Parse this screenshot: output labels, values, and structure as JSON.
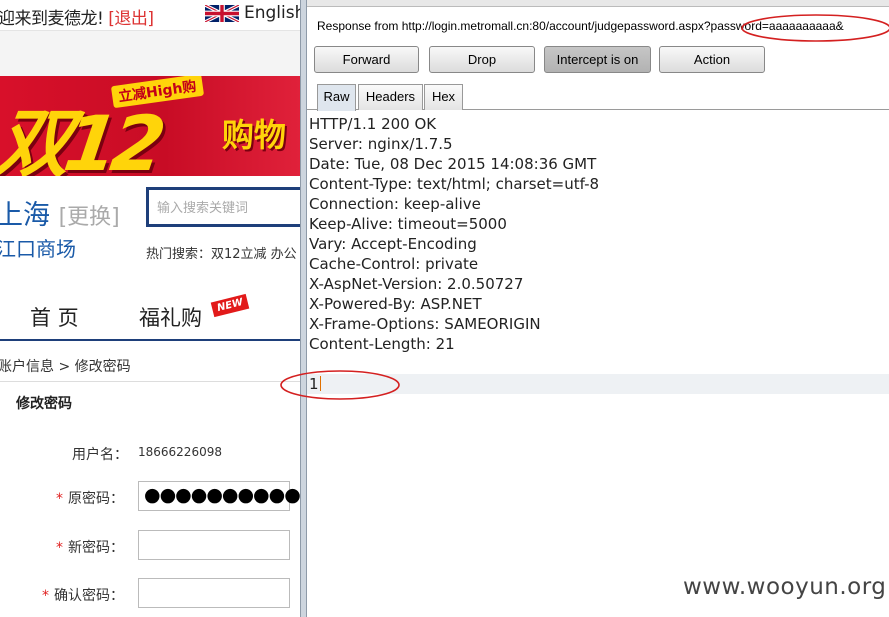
{
  "website": {
    "welcome_text": "迎来到麦德龙!",
    "logout_link": "[退出]",
    "language": "English",
    "banner": {
      "badge": "立减High购",
      "big_text": "双12",
      "suffix": "购物"
    },
    "city": "上海",
    "city_switch": "[更换]",
    "mall_name": "江口商场",
    "search": {
      "placeholder": "输入搜索关键词"
    },
    "hot_search": "热门搜索：双12立减  办公",
    "nav": [
      {
        "label": "首 页"
      },
      {
        "label": "福礼购",
        "tag": "NEW"
      }
    ],
    "breadcrumb": "账户信息 > 修改密码",
    "form": {
      "title": "修改密码",
      "username_label": "用户名：",
      "username_value": "18666226098",
      "old_password_label": "原密码：",
      "old_password_dots": "●●●●●●●●●●●",
      "new_password_label": "新密码：",
      "confirm_password_label": "确认密码：",
      "required_mark": "*"
    }
  },
  "burp": {
    "response_from": "Response from http://login.metromall.cn:80/account/judgepassword.aspx?password=aaaaaaaaaa&",
    "buttons": {
      "forward": "Forward",
      "drop": "Drop",
      "intercept": "Intercept is on",
      "action": "Action"
    },
    "tabs": [
      "Raw",
      "Headers",
      "Hex"
    ],
    "active_tab": "Raw",
    "headers": [
      "HTTP/1.1 200 OK",
      "Server: nginx/1.7.5",
      "Date: Tue, 08 Dec 2015 14:08:36 GMT",
      "Content-Type: text/html; charset=utf-8",
      "Connection: keep-alive",
      "Keep-Alive: timeout=5000",
      "Vary: Accept-Encoding",
      "Cache-Control: private",
      "X-AspNet-Version: 2.0.50727",
      "X-Powered-By: ASP.NET",
      "X-Frame-Options: SAMEORIGIN",
      "Content-Length: 21"
    ],
    "body": "1"
  },
  "watermark": "www.wooyun.org",
  "colors": {
    "annotation": "#d42020",
    "banner_red": "#d8102a",
    "banner_yellow": "#ffd40a",
    "link_blue": "#1a5aa8"
  }
}
